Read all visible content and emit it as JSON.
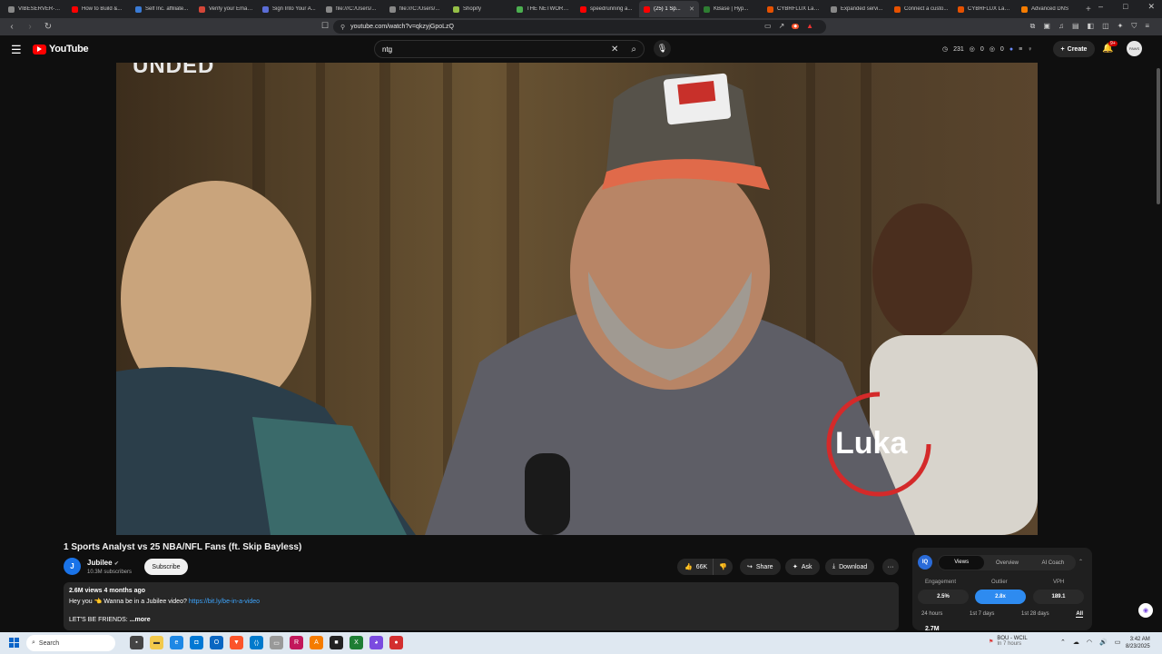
{
  "browser": {
    "tabs": [
      {
        "label": "VIBESERVER-1:8...",
        "color": "#888888"
      },
      {
        "label": "How to Build &...",
        "color": "#ff0000"
      },
      {
        "label": "Self Inc. affiliate...",
        "color": "#3a7bd5"
      },
      {
        "label": "Verify your Email...",
        "color": "#d44638"
      },
      {
        "label": "Sign Into Your A...",
        "color": "#5b6dd6"
      },
      {
        "label": "file:///C:/Users/...",
        "color": "#888888"
      },
      {
        "label": "file:///C:/Users/...",
        "color": "#888888"
      },
      {
        "label": "Shopify",
        "color": "#95bf47"
      },
      {
        "label": "THE NETWORK...",
        "color": "#4caf50"
      },
      {
        "label": "speedrunning a...",
        "color": "#ff0000"
      },
      {
        "label": "(25) 1 Sp...",
        "color": "#ff0000",
        "active": true
      },
      {
        "label": "KBase | Hyp...",
        "color": "#2e7d32"
      },
      {
        "label": "CYBRFLUX Land...",
        "color": "#e65100"
      },
      {
        "label": "Expanded servi...",
        "color": "#888888"
      },
      {
        "label": "Connect a custo...",
        "color": "#e65100"
      },
      {
        "label": "CYBRFLUX Land...",
        "color": "#e65100"
      },
      {
        "label": "Advanced DNS",
        "color": "#f57c00"
      }
    ],
    "new_tab": "+",
    "url": "youtube.com/watch?v=qkzyjGpoLzQ"
  },
  "youtube": {
    "logo_text": "YouTube",
    "search_value": "ntg",
    "stats": {
      "a": "231",
      "b": "0",
      "c": "0"
    },
    "create_label": "Create",
    "notif_badge": "9+",
    "avatar_text": "PAWS"
  },
  "video": {
    "overlay_top": "UNDED",
    "overlay_name": "Luka",
    "title": "1 Sports Analyst vs 25 NBA/NFL Fans (ft. Skip Bayless)",
    "channel": "Jubilee",
    "channel_initial": "J",
    "subscribers": "10.3M subscribers",
    "subscribe_label": "Subscribe",
    "likes": "66K",
    "share_label": "Share",
    "ask_label": "Ask",
    "download_label": "Download",
    "more_label": "···",
    "desc_meta": "2.6M views  4 months ago",
    "desc_line1": "Hey you 👈 Wanna be in a Jubilee video?",
    "desc_link": "https://bit.ly/be-in-a-video",
    "desc_line2": "LET'S BE FRIENDS:",
    "desc_more": "...more"
  },
  "iq_panel": {
    "badge": "IQ",
    "tabs": [
      "Views",
      "Overview",
      "AI Coach"
    ],
    "metrics": [
      {
        "label": "Engagement",
        "value": "2.5%"
      },
      {
        "label": "Outlier",
        "value": "2.8x"
      },
      {
        "label": "VPH",
        "value": "189.1"
      }
    ],
    "ranges": [
      "24 hours",
      "1st 7 days",
      "1st 28 days",
      "All"
    ],
    "bottom_value": "2.7M"
  },
  "taskbar": {
    "search_label": "Search",
    "weather_title": "BOU - WCIL",
    "weather_sub": "In 7 hours",
    "time": "3:42 AM",
    "date": "8/23/2025"
  },
  "colors": {
    "youtube_red": "#ff0000",
    "accent_blue": "#2e8bf0",
    "link_blue": "#3ea6ff"
  }
}
